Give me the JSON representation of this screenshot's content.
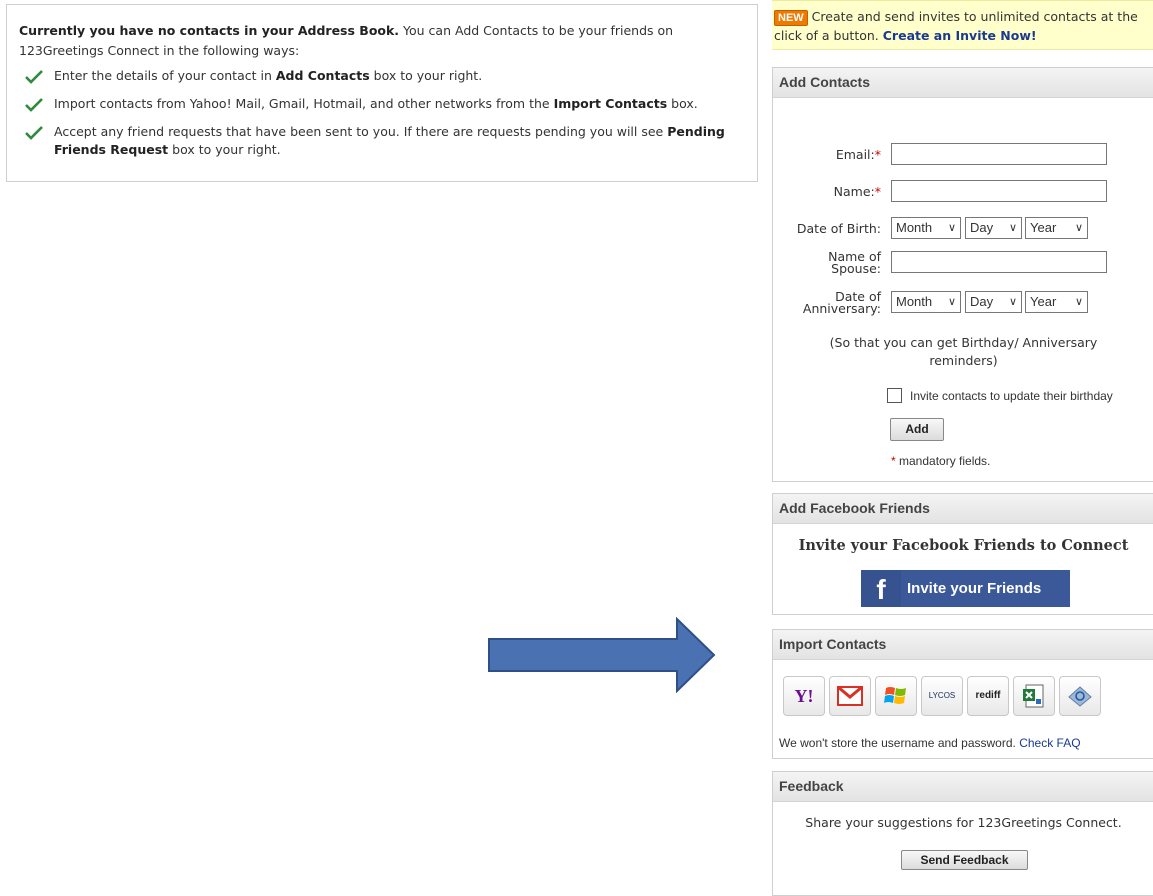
{
  "info": {
    "intro_bold": "Currently you have no contacts in your Address Book.",
    "intro_rest": " You can Add Contacts to be your friends on 123Greetings Connect in the following ways:",
    "items": [
      {
        "pre": "Enter the details of your contact in ",
        "bold": "Add Contacts",
        "post": " box to your right."
      },
      {
        "pre": "Import contacts from Yahoo! Mail, Gmail, Hotmail, and other networks from the ",
        "bold": "Import Contacts",
        "post": " box."
      },
      {
        "pre": "Accept any friend requests that have been sent to you. If there are requests pending you will see ",
        "bold": "Pending Friends Request",
        "post": " box to your right."
      }
    ]
  },
  "promo": {
    "badge": "NEW",
    "text": "Create and send invites to unlimited contacts at the click of a button.",
    "link": "Create an Invite Now!"
  },
  "add_contacts": {
    "title": "Add Contacts",
    "email_label": "Email:",
    "name_label": "Name:",
    "dob_label": "Date of Birth:",
    "spouse_label_1": "Name of",
    "spouse_label_2": "Spouse:",
    "anniv_label_1": "Date of",
    "anniv_label_2": "Anniversary:",
    "required_mark": "*",
    "month": "Month",
    "day": "Day",
    "year": "Year",
    "reminder_note": "(So that you can get Birthday/ Anniversary reminders)",
    "invite_checkbox_label": "Invite contacts to update their birthday",
    "add_button": "Add",
    "mandatory_note": "mandatory fields."
  },
  "facebook": {
    "title": "Add Facebook Friends",
    "heading": "Invite your Facebook Friends to Connect",
    "button_icon": "f",
    "button_label": "Invite your Friends"
  },
  "import": {
    "title": "Import Contacts",
    "providers": [
      "yahoo-icon",
      "gmail-icon",
      "windows-live-icon",
      "lycos-icon",
      "rediff-icon",
      "excel-csv-icon",
      "outlook-icon"
    ],
    "yahoo_text": "Y!",
    "lycos_text": "LYCOS",
    "rediff_text": "rediff",
    "note": "We won't store the username and password.",
    "faq_link": "Check FAQ"
  },
  "feedback": {
    "title": "Feedback",
    "note": "Share your suggestions for 123Greetings Connect.",
    "button": "Send Feedback"
  },
  "colors": {
    "arrow_fill": "#4a72b2",
    "facebook_blue": "#3b5998",
    "check_green": "#2e8b3a",
    "promo_bg": "#ffffcc",
    "required_red": "#cc0000"
  }
}
